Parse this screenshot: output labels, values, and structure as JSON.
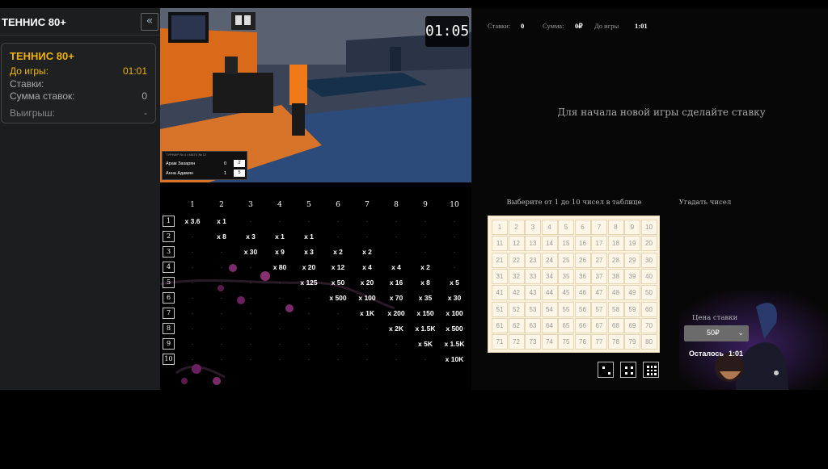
{
  "sidebar": {
    "title": "ТЕННИС 80+",
    "collapse_icon": "«",
    "card": {
      "title": "ТЕННИС 80+",
      "time_label": "До игры:",
      "time_value": "01:01",
      "bets_label": "Ставки:",
      "sum_label": "Сумма ставок:",
      "sum_value": "0",
      "win_label": "Выигрыш:",
      "win_value": "-"
    }
  },
  "video": {
    "timer": "01:05",
    "scoreboard": {
      "header": "ТУРНИР № 4 • МАТЧ № 12",
      "players": [
        {
          "name": "Арам Захарян",
          "games": "0",
          "points": "2"
        },
        {
          "name": "Анна Адамян",
          "games": "1",
          "points": "5"
        }
      ]
    }
  },
  "stats": {
    "bets_label": "Ставки:",
    "bets_value": "0",
    "sum_label": "Сумма:",
    "sum_value": "0₽",
    "time_label": "До игры",
    "time_value": "1:01"
  },
  "message": "Для начала новой игры сделайте ставку",
  "pick_label": "Выберите от 1 до 10 чисел в таблице",
  "guess_label": "Угадать чисел",
  "multiplier_table": {
    "columns": [
      "1",
      "2",
      "3",
      "4",
      "5",
      "6",
      "7",
      "8",
      "9",
      "10"
    ],
    "rows": [
      [
        "x 3.6",
        "x 1",
        "",
        "",
        "",
        "",
        "",
        "",
        "",
        ""
      ],
      [
        "",
        "x 8",
        "x 3",
        "x 1",
        "x 1",
        "",
        "",
        "",
        "",
        ""
      ],
      [
        "",
        "",
        "x 30",
        "x 9",
        "x 3",
        "x 2",
        "x 2",
        "",
        "",
        ""
      ],
      [
        "",
        "",
        "",
        "x 80",
        "x 20",
        "x 12",
        "x 4",
        "x 4",
        "x 2",
        ""
      ],
      [
        "",
        "",
        "",
        "",
        "x 125",
        "x 50",
        "x 20",
        "x 16",
        "x 8",
        "x 5"
      ],
      [
        "",
        "",
        "",
        "",
        "",
        "x 500",
        "x 100",
        "x 70",
        "x 35",
        "x 30"
      ],
      [
        "",
        "",
        "",
        "",
        "",
        "",
        "x 1K",
        "x 200",
        "x 150",
        "x 100"
      ],
      [
        "",
        "",
        "",
        "",
        "",
        "",
        "",
        "x 2K",
        "x 1.5K",
        "x 500"
      ],
      [
        "",
        "",
        "",
        "",
        "",
        "",
        "",
        "",
        "x 5K",
        "x 1.5K"
      ],
      [
        "",
        "",
        "",
        "",
        "",
        "",
        "",
        "",
        "",
        "x 10K"
      ]
    ]
  },
  "number_grid": [
    "1",
    "2",
    "3",
    "4",
    "5",
    "6",
    "7",
    "8",
    "9",
    "10",
    "11",
    "12",
    "13",
    "14",
    "15",
    "16",
    "17",
    "18",
    "19",
    "20",
    "21",
    "22",
    "23",
    "24",
    "25",
    "26",
    "27",
    "28",
    "29",
    "30",
    "31",
    "32",
    "33",
    "34",
    "35",
    "36",
    "37",
    "38",
    "39",
    "40",
    "41",
    "42",
    "43",
    "44",
    "45",
    "46",
    "47",
    "48",
    "49",
    "50",
    "51",
    "52",
    "53",
    "54",
    "55",
    "56",
    "57",
    "58",
    "59",
    "60",
    "61",
    "62",
    "63",
    "64",
    "65",
    "66",
    "67",
    "68",
    "69",
    "70",
    "71",
    "72",
    "73",
    "74",
    "75",
    "76",
    "77",
    "78",
    "79",
    "80"
  ],
  "quick_pick_icons": [
    "dice-two-icon",
    "dice-four-icon",
    "grid-nine-icon"
  ],
  "bet": {
    "price_label": "Цена ставки",
    "price_value": "50₽",
    "chevron": "⌄",
    "remain_label": "Осталось",
    "remain_value": "1:01"
  }
}
